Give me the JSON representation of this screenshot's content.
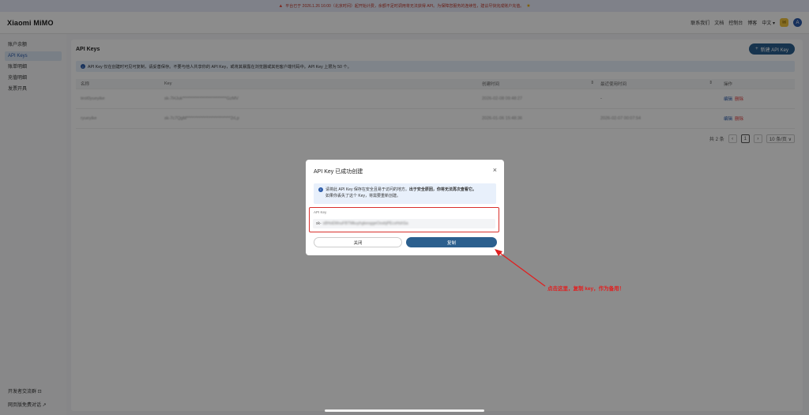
{
  "banner": {
    "text": "平台已于 2026.1.26 16:00（北京时间）起开始计费，余额不足时调用将无法获得 API。为保障您服务的连续性，建议尽快完成账户充值。"
  },
  "header": {
    "logo": "Xiaomi MiMO",
    "nav": [
      "联系我们",
      "文档",
      "控制台",
      "博客"
    ],
    "lang": "中文 ▾",
    "avatar": "A"
  },
  "sidebar": {
    "items": [
      {
        "label": "账户余额"
      },
      {
        "label": "API Keys"
      },
      {
        "label": "账单明细"
      },
      {
        "label": "充值明细"
      },
      {
        "label": "发票开具"
      }
    ],
    "bottom": [
      "开发者交流群 ⊡",
      "网页版免费对话 ↗"
    ]
  },
  "main": {
    "title": "API Keys",
    "new_button": "新建 API Key",
    "info": "API Key 仅在创建时可见可复制，请妥善保存。不要与他人共享你的 API Key，或将其暴露在浏览器或其他客户端代码中。API Key 上限为 50 个。",
    "columns": [
      "名称",
      "Key",
      "创建时间",
      "最近使用时间",
      "操作"
    ],
    "rows": [
      {
        "name": "test0yueyike",
        "key": "sk-7HJuk**************************GzMV",
        "created": "2026-02-08 09:48:27",
        "last_used": "-",
        "edit": "编辑",
        "delete": "删除"
      },
      {
        "name": "ryueyike",
        "key": "sk-7c7QgM**************************2rLp",
        "created": "2026-01-06 15:48:36",
        "last_used": "2026-02-07 00:07:54",
        "edit": "编辑",
        "delete": "删除"
      }
    ],
    "pager": {
      "total": "共 2 条",
      "prev": "‹",
      "page": "1",
      "next": "›",
      "size": "10 条/页 ∨"
    }
  },
  "modal": {
    "title": "API Key 已成功创建",
    "close_icon": "×",
    "info_line1_a": "请将此 API Key 保存在安全且易于访问的地方。",
    "info_line1_b": "出于安全原因，你将无法再次查看它。",
    "info_line2": "如果你丢失了这个 Key，将需要重新创建。",
    "key_label": "API Key",
    "key_prefix": "sk-",
    "key_rest": "s8HoEMnuFBTMkuyhgkeoggeOoxbjPEcxHshSa",
    "close_button": "关闭",
    "copy_button": "复制"
  },
  "annotation": {
    "text": "点击这里，复制 key，作为备用！"
  },
  "colors": {
    "accent": "#2b5f8e",
    "highlight": "#d9302c"
  }
}
